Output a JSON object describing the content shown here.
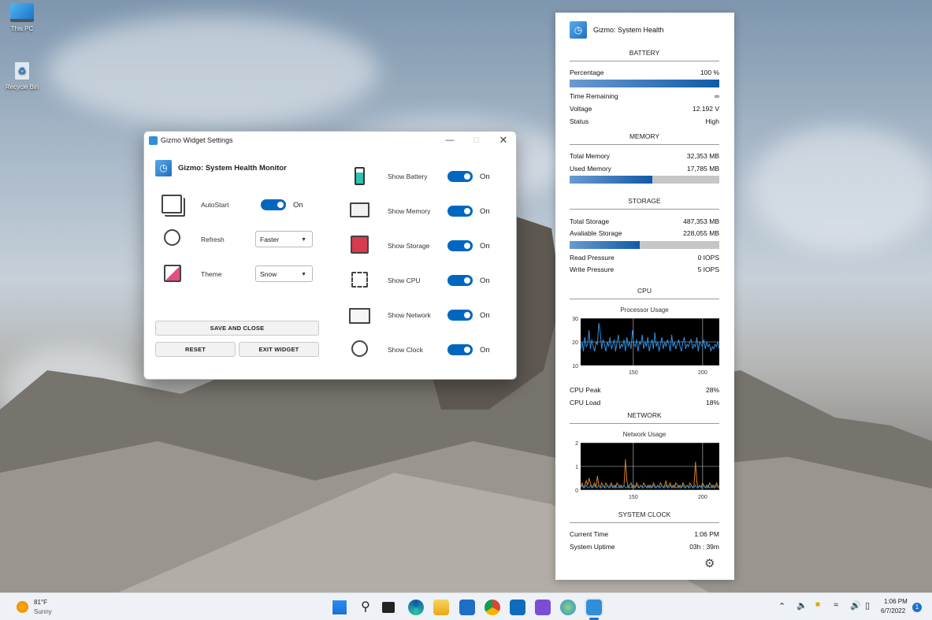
{
  "desktop": {
    "icons": [
      {
        "label": "This PC",
        "icon": "monitor-icon"
      },
      {
        "label": "Recycle Bin",
        "icon": "recycle-bin-icon"
      }
    ]
  },
  "settings_window": {
    "title": "Gizmo Widget Settings",
    "app_name": "Gizmo: System Health Monitor",
    "autostart": {
      "label": "AutoStart",
      "state": "On"
    },
    "refresh": {
      "label": "Refresh",
      "value": "Faster"
    },
    "theme": {
      "label": "Theme",
      "value": "Snow"
    },
    "buttons": {
      "save_close": "SAVE AND CLOSE",
      "reset": "RESET",
      "exit": "EXIT WIDGET"
    },
    "toggles": [
      {
        "label": "Show Battery",
        "state": "On",
        "icon": "battery-icon"
      },
      {
        "label": "Show Memory",
        "state": "On",
        "icon": "memory-icon"
      },
      {
        "label": "Show Storage",
        "state": "On",
        "icon": "storage-icon"
      },
      {
        "label": "Show CPU",
        "state": "On",
        "icon": "cpu-icon"
      },
      {
        "label": "Show Network",
        "state": "On",
        "icon": "network-icon"
      },
      {
        "label": "Show Clock",
        "state": "On",
        "icon": "clock-icon"
      }
    ]
  },
  "widget": {
    "title": "Gizmo: System Health",
    "battery": {
      "heading": "BATTERY",
      "percentage_label": "Percentage",
      "percentage_value": "100 %",
      "percentage_fraction": 1.0,
      "time_label": "Time Remaining",
      "time_value": "∞",
      "voltage_label": "Voltage",
      "voltage_value": "12.192 V",
      "status_label": "Status",
      "status_value": "High"
    },
    "memory": {
      "heading": "MEMORY",
      "total_label": "Total Memory",
      "total_value": "32,353 MB",
      "used_label": "Used Memory",
      "used_value": "17,785 MB",
      "used_fraction": 0.55
    },
    "storage": {
      "heading": "STORAGE",
      "total_label": "Total Storage",
      "total_value": "487,353 MB",
      "avail_label": "Avaliable Storage",
      "avail_value": "228,055 MB",
      "used_fraction": 0.47,
      "read_label": "Read Pressure",
      "read_value": "0 IOPS",
      "write_label": "Write Pressure",
      "write_value": "5 IOPS"
    },
    "cpu": {
      "heading": "CPU",
      "chart_title": "Processor Usage",
      "peak_label": "CPU Peak",
      "peak_value": "28%",
      "load_label": "CPU Load",
      "load_value": "18%"
    },
    "network": {
      "heading": "NETWORK",
      "chart_title": "Network Usage"
    },
    "clock": {
      "heading": "SYSTEM CLOCK",
      "time_label": "Current Time",
      "time_value": "1:06 PM",
      "uptime_label": "System Uptime",
      "uptime_value": "03h : 39m"
    }
  },
  "chart_data": [
    {
      "type": "line",
      "title": "Processor Usage",
      "xlim": [
        112,
        212
      ],
      "ylim": [
        10,
        30
      ],
      "xticks": [
        "150",
        "200"
      ],
      "yticks": [
        "30",
        "20",
        "10"
      ],
      "grid": true,
      "series": [
        {
          "color": "#2f8fe0",
          "values": [
            17,
            20,
            16,
            22,
            18,
            19,
            25,
            17,
            21,
            18,
            16,
            20,
            19,
            28,
            24,
            17,
            21,
            19,
            16,
            20,
            18,
            22,
            17,
            19,
            21,
            16,
            20,
            23,
            17,
            19,
            18,
            21,
            16,
            22,
            18,
            20,
            17,
            25,
            19,
            18,
            21,
            16,
            20,
            19,
            23,
            17,
            20,
            18,
            22,
            16,
            19,
            21,
            17,
            24,
            18,
            20,
            16,
            19,
            22,
            17,
            20,
            18,
            21,
            19,
            16,
            23,
            18,
            20,
            17,
            19,
            21,
            18,
            16,
            20,
            22,
            17,
            19,
            18,
            20,
            21,
            17,
            19,
            18,
            22,
            16,
            20,
            19,
            18,
            21,
            17,
            20,
            18,
            19,
            16,
            18,
            17,
            19,
            18,
            20,
            17
          ]
        }
      ]
    },
    {
      "type": "line",
      "title": "Network Usage",
      "xlim": [
        112,
        212
      ],
      "ylim": [
        0,
        2
      ],
      "xticks": [
        "150",
        "200"
      ],
      "yticks": [
        "2",
        "1",
        "0"
      ],
      "grid": true,
      "series": [
        {
          "color": "#d6801e",
          "values": [
            0.1,
            0.3,
            0.1,
            0.2,
            0.4,
            0.2,
            0.5,
            0.3,
            0.1,
            0.2,
            0.3,
            0.1,
            0.6,
            0.2,
            0.1,
            0.3,
            0.2,
            0.1,
            0.3,
            0.2,
            0.1,
            0.2,
            0.3,
            0.1,
            0.2,
            0.1,
            0.3,
            0.2,
            0.1,
            0.2,
            0.1,
            0.2,
            1.3,
            0.4,
            0.1,
            0.2,
            0.3,
            0.1,
            0.2,
            0.1,
            0.3,
            0.2,
            0.1,
            0.2,
            0.1,
            0.3,
            0.2,
            0.1,
            0.2,
            0.1,
            0.2,
            0.1,
            0.3,
            0.2,
            0.1,
            0.2,
            0.1,
            0.3,
            0.2,
            0.1,
            0.2,
            0.4,
            0.1,
            0.2,
            0.3,
            0.1,
            0.2,
            0.1,
            0.3,
            0.2,
            0.1,
            0.2,
            0.1,
            0.3,
            0.2,
            0.1,
            0.2,
            0.1,
            0.3,
            0.2,
            0.1,
            0.2,
            1.2,
            0.3,
            0.1,
            0.2,
            0.1,
            0.3,
            0.2,
            0.1,
            0.2,
            0.1,
            0.3,
            0.2,
            0.1,
            0.2,
            0.1,
            0.3,
            0.2,
            0.1
          ]
        },
        {
          "color": "#2f8fe0",
          "values": [
            0.1,
            0.2,
            0.1,
            0.1,
            0.2,
            0.1,
            0.1,
            0.2,
            0.1,
            0.1,
            0.2,
            0.1,
            0.1,
            0.2,
            0.1,
            0.1,
            0.2,
            0.1,
            0.1,
            0.2,
            0.1,
            0.1,
            0.2,
            0.1,
            0.1,
            0.2,
            0.1,
            0.1,
            0.2,
            0.1,
            0.1,
            0.2,
            0.1,
            0.1,
            0.2,
            0.1,
            0.1,
            0.2,
            0.1,
            0.1,
            0.2,
            0.1,
            0.1,
            0.2,
            0.1,
            0.1,
            0.2,
            0.1,
            0.1,
            0.2,
            0.1,
            0.1,
            0.2,
            0.1,
            0.1,
            0.2,
            0.1,
            0.1,
            0.2,
            0.1,
            0.1,
            0.2,
            0.1,
            0.1,
            0.2,
            0.1,
            0.1,
            0.2,
            0.1,
            0.1,
            0.2,
            0.1,
            0.1,
            0.2,
            0.1,
            0.1,
            0.2,
            0.1,
            0.1,
            0.2,
            0.1,
            0.1,
            0.2,
            0.1,
            0.1,
            0.2,
            0.1,
            0.1,
            0.2,
            0.1,
            0.1,
            0.2,
            0.1,
            0.1,
            0.2,
            0.1,
            0.1,
            0.2,
            0.1,
            0.1
          ]
        }
      ]
    }
  ],
  "taskbar": {
    "weather_temp": "81°F",
    "weather_desc": "Sunny",
    "clock_time": "1:06 PM",
    "clock_date": "6/7/2022",
    "notification_count": "1",
    "apps": [
      "windows-start-icon",
      "search-icon",
      "task-view-icon",
      "edge-icon",
      "file-explorer-icon",
      "store-icon",
      "chrome-icon",
      "outlook-icon",
      "visual-studio-icon",
      "browser-globe-icon",
      "gizmo-icon"
    ]
  },
  "colors": {
    "accent": "#0067c0",
    "bar_fill": "#0f5aa8",
    "chart_bg": "#000000",
    "cpu_line": "#2f8fe0",
    "net_line": "#d6801e"
  }
}
